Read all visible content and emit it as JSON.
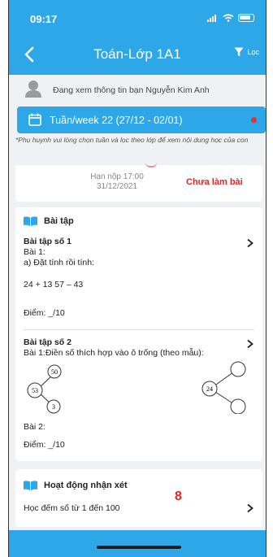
{
  "status_bar": {
    "time": "09:17"
  },
  "nav": {
    "title": "Toán-Lớp 1A1",
    "filter_label": "Lọc"
  },
  "user": {
    "viewing_text": "Đang xem thông tin bạn Nguyễn Kim Anh"
  },
  "week": {
    "label": "Tuần/week 22 (27/12 - 02/01)"
  },
  "note": "*Phụ huynh vui lòng chọn tuần và lọc theo lớp để xem nội dung học của con",
  "submission": {
    "deadline_line1": "Hạn nộp 17:00",
    "deadline_line2": "31/12/2021",
    "status": "Chưa làm bài"
  },
  "exercises": {
    "section_title": "Bài tập",
    "items": [
      {
        "title": "Bài tập số 1",
        "line1": "Bài 1:",
        "line2": "a) Đặt tính rồi tính:",
        "calc": "24 + 13 57 – 43",
        "score": "Điểm: _/10"
      },
      {
        "title": "Bài tập số 2",
        "line1": "Bài 1:Điền số thích hợp vào ô trống (theo mẫu):",
        "tree1": {
          "top": "50",
          "left": "53",
          "bottom": "3"
        },
        "tree2": {
          "left": "24"
        },
        "line_bai2": "Bài 2:",
        "score": "Điểm: _/10"
      }
    ]
  },
  "review": {
    "section_title": "Hoạt động nhận xét",
    "topic": "Học đếm số từ 1 đến 100",
    "badge": "8"
  },
  "colors": {
    "primary": "#2ea7e8",
    "status_red": "#d62b2b",
    "background": "#f0f1f4"
  },
  "icons": [
    "back-arrow-icon",
    "filter-icon",
    "avatar-icon",
    "calendar-icon",
    "book-icon",
    "chevron-right-icon"
  ]
}
